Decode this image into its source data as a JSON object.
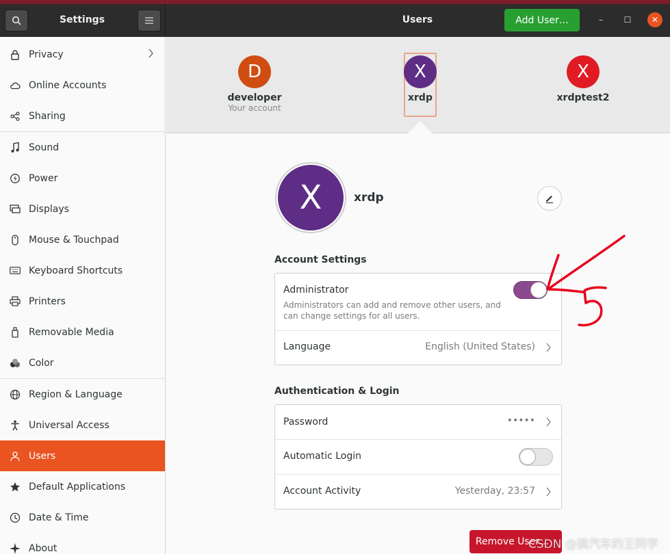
{
  "window": {
    "sidebar_title": "Settings",
    "main_title": "Users",
    "add_user_label": "Add User…",
    "minimize_glyph": "–",
    "maximize_glyph": "☐",
    "close_glyph": "✕"
  },
  "sidebar": {
    "items": [
      {
        "label": "Privacy",
        "icon": "lock-icon"
      },
      {
        "label": "Online Accounts",
        "icon": "cloud-icon"
      },
      {
        "label": "Sharing",
        "icon": "share-icon"
      },
      {
        "label": "Sound",
        "icon": "music-note-icon"
      },
      {
        "label": "Power",
        "icon": "power-icon"
      },
      {
        "label": "Displays",
        "icon": "display-icon"
      },
      {
        "label": "Mouse & Touchpad",
        "icon": "mouse-icon"
      },
      {
        "label": "Keyboard Shortcuts",
        "icon": "keyboard-icon"
      },
      {
        "label": "Printers",
        "icon": "printer-icon"
      },
      {
        "label": "Removable Media",
        "icon": "usb-drive-icon"
      },
      {
        "label": "Color",
        "icon": "color-icon"
      },
      {
        "label": "Region & Language",
        "icon": "globe-icon"
      },
      {
        "label": "Universal Access",
        "icon": "accessibility-icon"
      },
      {
        "label": "Users",
        "icon": "users-icon"
      },
      {
        "label": "Default Applications",
        "icon": "star-icon"
      },
      {
        "label": "Date & Time",
        "icon": "clock-icon"
      },
      {
        "label": "About",
        "icon": "sparkle-icon"
      }
    ],
    "active": "Users"
  },
  "users": [
    {
      "initial": "D",
      "name": "developer",
      "subtitle": "Your account",
      "color": "#d04d12"
    },
    {
      "initial": "X",
      "name": "xrdp",
      "subtitle": "",
      "color": "#5e2d86"
    },
    {
      "initial": "X",
      "name": "xrdptest2",
      "subtitle": "",
      "color": "#e01b24"
    }
  ],
  "selected_user": {
    "initial": "X",
    "name": "xrdp"
  },
  "account_settings": {
    "title": "Account Settings",
    "administrator_label": "Administrator",
    "administrator_desc": "Administrators can add and remove other users, and can change settings for all users.",
    "administrator_on": true,
    "language_label": "Language",
    "language_value": "English (United States)"
  },
  "auth": {
    "title": "Authentication & Login",
    "password_label": "Password",
    "password_value": "•••••",
    "auto_login_label": "Automatic Login",
    "auto_login_on": false,
    "activity_label": "Account Activity",
    "activity_value": "Yesterday, 23:57"
  },
  "remove_user_label": "Remove User…",
  "watermark": "CSDN @搞汽车的王同学",
  "colors": {
    "accent": "#e95420",
    "add_button": "#27a031",
    "remove_button": "#c7162b",
    "toggle_on": "#8b4a8d"
  }
}
